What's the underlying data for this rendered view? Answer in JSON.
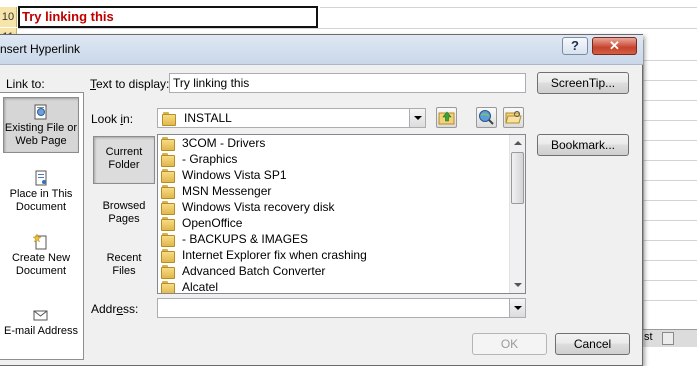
{
  "spreadsheet": {
    "row_10_number": "10",
    "row_11_number": "11",
    "cell_text": "Try linking this",
    "tab_fragment": "st"
  },
  "dialog": {
    "title": "nsert Hyperlink",
    "help_button": "?",
    "close_button": "✕",
    "link_to_label": "Link to:",
    "link_to_items": [
      {
        "line1": "Existing File or",
        "line2": "Web Page",
        "icon": "web-page-icon",
        "selected": true
      },
      {
        "line1": "Place in This",
        "line2": "Document",
        "icon": "document-place-icon",
        "selected": false
      },
      {
        "line1": "Create New",
        "line2": "Document",
        "icon": "new-document-icon",
        "selected": false
      },
      {
        "line1": "E-mail Address",
        "line2": "",
        "icon": "email-icon",
        "selected": false
      }
    ],
    "text_to_display_label": "Text to display:",
    "text_to_display_value": "Try linking this",
    "screentip_button": "ScreenTip...",
    "look_in_label": "Look in:",
    "look_in_value": "INSTALL",
    "bookmark_button": "Bookmark...",
    "side_tabs": [
      {
        "line1": "Current",
        "line2": "Folder",
        "selected": true
      },
      {
        "line1": "Browsed",
        "line2": "Pages",
        "selected": false
      },
      {
        "line1": "Recent",
        "line2": "Files",
        "selected": false
      }
    ],
    "files": [
      "3COM - Drivers",
      "- Graphics",
      "Windows Vista SP1",
      "MSN Messenger",
      "Windows Vista recovery disk",
      "OpenOffice",
      "- BACKUPS & IMAGES",
      "Internet Explorer fix when crashing",
      "Advanced Batch Converter",
      "Alcatel"
    ],
    "address_label": "Address:",
    "address_value": "",
    "ok_button": "OK",
    "cancel_button": "Cancel"
  }
}
